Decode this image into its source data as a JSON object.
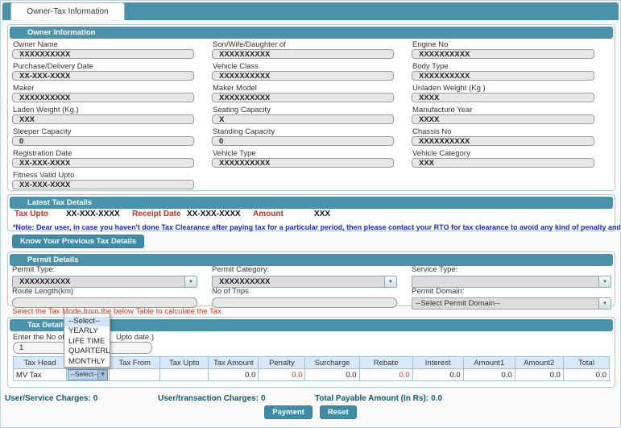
{
  "tab_bar": {
    "active_tab_label": "Owner-Tax Information"
  },
  "owner_information": {
    "title": "Owner Information",
    "fields": [
      {
        "label": "Owner Name",
        "value": "XXXXXXXXXX"
      },
      {
        "label": "Son/Wife/Daughter of",
        "value": "XXXXXXXXXX"
      },
      {
        "label": "Engine No",
        "value": "XXXXXXXXXX"
      },
      {
        "label": "Purchase/Delivery Date",
        "value": "XX-XXX-XXXX"
      },
      {
        "label": "Vehicle Class",
        "value": "XXXXXXXXXX"
      },
      {
        "label": "Body Type",
        "value": "XXXXXXXXXX"
      },
      {
        "label": "Maker",
        "value": "XXXXXXXXXX"
      },
      {
        "label": "Maker Model",
        "value": "XXXXXXXXXX"
      },
      {
        "label": "Unladen Weight (Kg )",
        "value": "XXXX"
      },
      {
        "label": "Laden Weight (Kg.)",
        "value": "XXX"
      },
      {
        "label": "Seating Capacity",
        "value": "X"
      },
      {
        "label": "Manufacture Year",
        "value": "XXXX"
      },
      {
        "label": "Sleeper Capacity",
        "value": "0"
      },
      {
        "label": "Standing Capacity",
        "value": "0"
      },
      {
        "label": "Chassis No",
        "value": "XXXXXXXXXX"
      },
      {
        "label": "Registration Date",
        "value": "XX-XXX-XXXX"
      },
      {
        "label": "Vehicle Type",
        "value": "XXXXXXXXXX"
      },
      {
        "label": "Vehicle Category",
        "value": "XXX"
      },
      {
        "label": "Fitness Valid Upto",
        "value": "XX-XXX-XXXX"
      }
    ]
  },
  "latest_tax_details": {
    "title": "Latest Tax Details",
    "tax_upto_label": "Tax Upto",
    "tax_upto_value": "XX-XXX-XXXX",
    "receipt_date_label": "Receipt Date",
    "receipt_date_value": "XX-XXX-XXXX",
    "amount_label": "Amount",
    "amount_value": "XXX",
    "note": "*Note: Dear user, in case you haven't done Tax Clearance after paying tax for a particular period, then please contact your RTO for tax clearance to avoid any kind of penalty and extra tax payment."
  },
  "buttons": {
    "know_previous_tax": "Know Your Previous Tax Details",
    "payment": "Payment",
    "reset": "Reset"
  },
  "permit_details": {
    "title": "Permit Details",
    "permit_type": {
      "label": "Permit Type:",
      "value": "XXXXXXXXXX"
    },
    "permit_category": {
      "label": "Permit Category:",
      "value": "XXXXXXXXXX"
    },
    "service_type": {
      "label": "Service Type:",
      "value": ""
    },
    "route_length": {
      "label": "Route Length(km)",
      "value": ""
    },
    "no_of_trips": {
      "label": "No of Trips",
      "value": ""
    },
    "permit_domain": {
      "label": "Permit Domain:",
      "value": "--Select Permit Domain--"
    }
  },
  "tax_mode_instruction": "Select the Tax Mode from the below Table to calculate the Tax",
  "tax_details": {
    "title": "Tax Details",
    "months_label_left": "Enter the No of Month",
    "months_label_right": "Upto date.)",
    "months_value": "1",
    "mode_dropdown": {
      "options": [
        "--Select--",
        "YEARLY",
        "LIFE TIME",
        "QUARTERLY",
        "MONTHLY"
      ],
      "selected": "--Select--"
    },
    "table": {
      "headers": [
        "Tax Head",
        "",
        "Tax From",
        "Tax Upto",
        "Tax Amount",
        "Penalty",
        "Surcharge",
        "Rebate",
        "Interest",
        "Amount1",
        "Amount2",
        "Total"
      ],
      "row": {
        "tax_head": "MV Tax",
        "mode": "--Select--",
        "tax_from": "",
        "tax_upto": "",
        "tax_amount": "0.0",
        "penalty": "0.0",
        "surcharge": "0.0",
        "rebate": "0.0",
        "interest": "0.0",
        "amount1": "0.0",
        "amount2": "0.0",
        "total": "0.0"
      }
    }
  },
  "summary": {
    "service_charges_label": "User/Service Charges:",
    "service_charges_value": "0",
    "transaction_charges_label": "User/transaction Charges:",
    "transaction_charges_value": "0",
    "total_payable_label": "Total Payable Amount (In Rs):",
    "total_payable_value": "0.0"
  },
  "colors": {
    "accent_teal": "#4992a9",
    "alert_red": "#cc2b1d",
    "note_blue": "#2323cd",
    "row_highlight": "#cfe4f7"
  }
}
